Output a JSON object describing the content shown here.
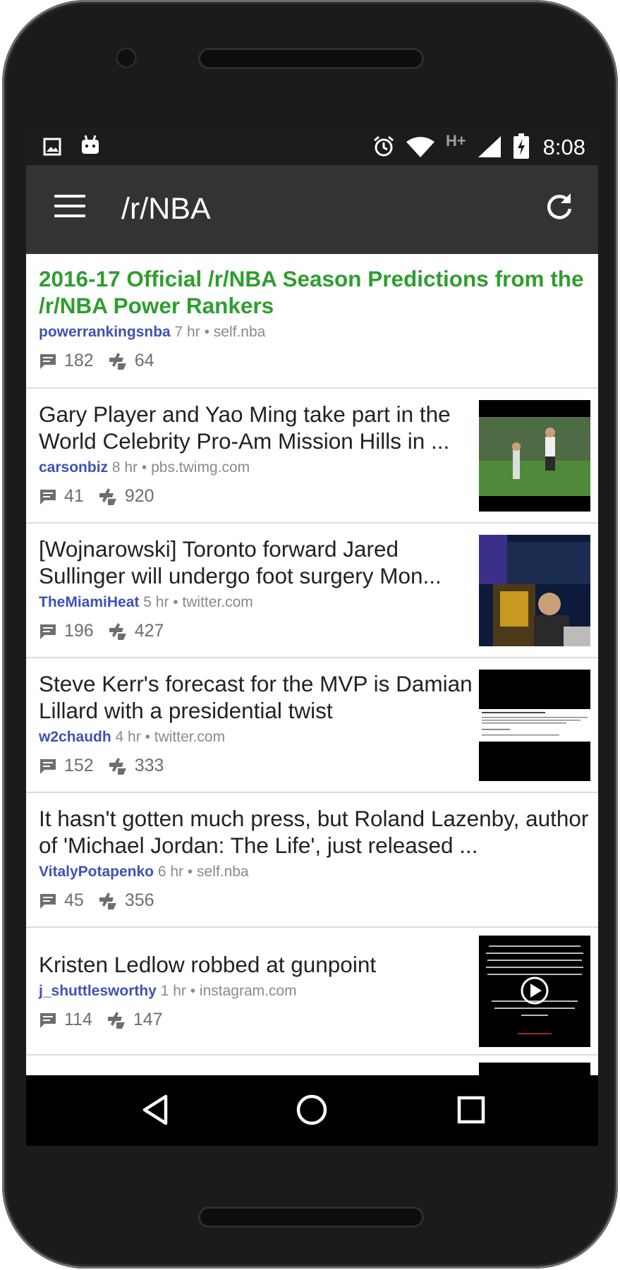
{
  "status_bar": {
    "time": "8:08",
    "network_label": "H+",
    "icons": [
      "image-icon",
      "android-icon",
      "alarm-icon",
      "wifi-icon",
      "signal-icon",
      "battery-charging-icon"
    ]
  },
  "app_bar": {
    "title": "/r/NBA",
    "menu_icon": "hamburger-menu-icon",
    "refresh_icon": "refresh-icon"
  },
  "posts": [
    {
      "title": "2016-17 Official /r/NBA Season Predictions from the /r/NBA Power Rankers",
      "author": "powerrankingsnba",
      "age": "7 hr",
      "domain": "• self.nba",
      "comments": "182",
      "score": "64",
      "sticky": true,
      "thumbnail": null
    },
    {
      "title": "Gary Player and Yao Ming take part in the World Celebrity Pro-Am Mission Hills in ...",
      "author": "carsonbiz",
      "age": "8 hr",
      "domain": "• pbs.twimg.com",
      "comments": "41",
      "score": "920",
      "thumbnail": "golf-photo"
    },
    {
      "title": "[Wojnarowski] Toronto forward Jared Sullinger will undergo foot surgery Mon...",
      "author": "TheMiamiHeat",
      "age": "5 hr",
      "domain": "• twitter.com",
      "comments": "196",
      "score": "427",
      "thumbnail": "studio-photo"
    },
    {
      "title": "Steve Kerr's forecast for the MVP is Damian Lillard with a presidential twist",
      "author": "w2chaudh",
      "age": "4 hr",
      "domain": "• twitter.com",
      "comments": "152",
      "score": "333",
      "thumbnail": "text-screenshot"
    },
    {
      "title": "It hasn't gotten much press, but Roland Lazenby, author of 'Michael Jordan: The Life', just released ...",
      "author": "VitalyPotapenko",
      "age": "6 hr",
      "domain": "• self.nba",
      "comments": "45",
      "score": "356",
      "thumbnail": null
    },
    {
      "title": "Kristen Ledlow robbed at gunpoint",
      "author": "j_shuttlesworthy",
      "age": "1 hr",
      "domain": "• instagram.com",
      "comments": "114",
      "score": "147",
      "thumbnail": "video-text"
    }
  ],
  "nav_bar": {
    "back_icon": "back-triangle-icon",
    "home_icon": "home-circle-icon",
    "recents_icon": "recents-square-icon"
  },
  "colors": {
    "app_bar": "#333333",
    "status_bar": "#1c1c1c",
    "sticky_title": "#2e9e2e",
    "author": "#3f51b5"
  }
}
